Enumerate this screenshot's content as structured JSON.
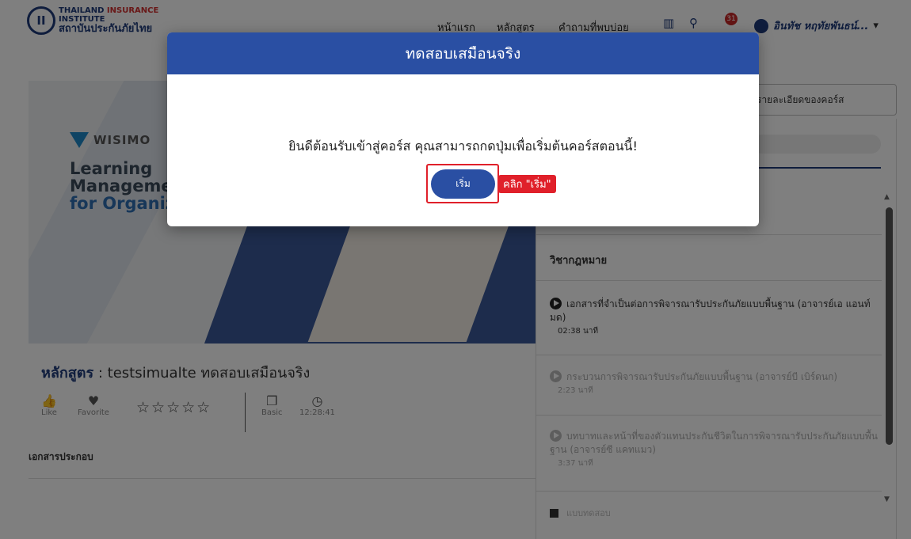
{
  "header": {
    "logo_en_line1": "THAILAND",
    "logo_en_line1b": "INSURANCE",
    "logo_en_line2": "INSTITUTE",
    "logo_th": "สถาบันประกันภัยไทย",
    "logo_mark": "II",
    "nav": [
      "หน้าแรก",
      "หลักสูตร",
      "คำถามที่พบบ่อย"
    ],
    "notification_count": "31",
    "user_name": "อินทัช หฤทัยพันธน์...",
    "user_caret": "▾"
  },
  "banner": {
    "brand": "WISIMO",
    "line1": "Learning",
    "line2": "Manageme",
    "line3": "for Organiz"
  },
  "course": {
    "label": "หลักสูตร",
    "name": " : testsimualte ทดสอบเสมือนจริง",
    "like_label": "Like",
    "favorite_label": "Favorite",
    "stars": "☆☆☆☆☆",
    "level": "Basic",
    "duration": "12:28:41",
    "documents_label": "เอกสารประกอบ"
  },
  "sidebar": {
    "detail_button": "รายละเอียดของคอร์ส",
    "section_title": "วิชากฎหมาย",
    "lessons": [
      {
        "title": "เอกสารที่จำเป็นต่อการพิจารณารับประกันภัยแบบพื้นฐาน (อาจารย์เอ แอนท์มด)",
        "duration": "02:38 นาที"
      },
      {
        "title": "กระบวนการพิจารณารับประกันภัยแบบพื้นฐาน (อาจารย์บี เบิร์ดนก)",
        "duration": "2:23 นาที"
      },
      {
        "title": "บทบาทและหน้าที่ของตัวแทนประกันชีวิตในการพิจารณารับประกันภัยแบบพื้นฐาน (อาจารย์ซี แคทแมว)",
        "duration": "3:37 นาที"
      }
    ],
    "quiz_label": "แบบทดสอบ"
  },
  "modal": {
    "title": "ทดสอบเสมือนจริง",
    "message": "ยินดีต้อนรับเข้าสู่คอร์ส คุณสามารถกดปุ่มเพื่อเริ่มต้นคอร์สตอนนี้!",
    "start_button": "เริ่ม",
    "hint": "คลิก \"เริ่ม\""
  },
  "colors": {
    "primary": "#2a4fa3",
    "highlight": "#e0202a",
    "badge": "#c62828"
  }
}
